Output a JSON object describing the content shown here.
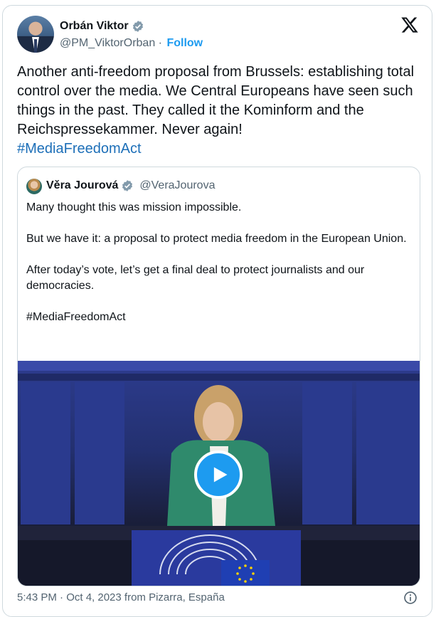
{
  "author": {
    "name": "Orbán Viktor",
    "handle": "@PM_ViktorOrban",
    "separator": "·",
    "follow_label": "Follow",
    "verified_icon": "verified-badge-icon"
  },
  "tweet": {
    "text": "Another anti-freedom proposal from Brussels: establishing total control over the media. We Central Europeans have seen such things in the past. They called it the Kominform and the Reichspressekammer. Never again!",
    "hashtag": "#MediaFreedomAct"
  },
  "quoted": {
    "name": "Věra Jourová",
    "handle": "@VeraJourova",
    "paragraphs": [
      "Many thought this was mission impossible.",
      "But we have it: a proposal to protect media freedom in the European Union.",
      "After today’s vote, let’s get a final deal to protect journalists and our democracies.",
      "#MediaFreedomAct"
    ],
    "media": {
      "type": "video",
      "play_icon": "play-icon"
    }
  },
  "footer": {
    "timestamp": "5:43 PM · Oct 4, 2023 from Pizarra, España"
  },
  "colors": {
    "accent": "#1d9bf0",
    "hashtag": "#1d6fb8",
    "text": "#0f1419",
    "muted": "#536471",
    "border": "#cfd9de"
  }
}
